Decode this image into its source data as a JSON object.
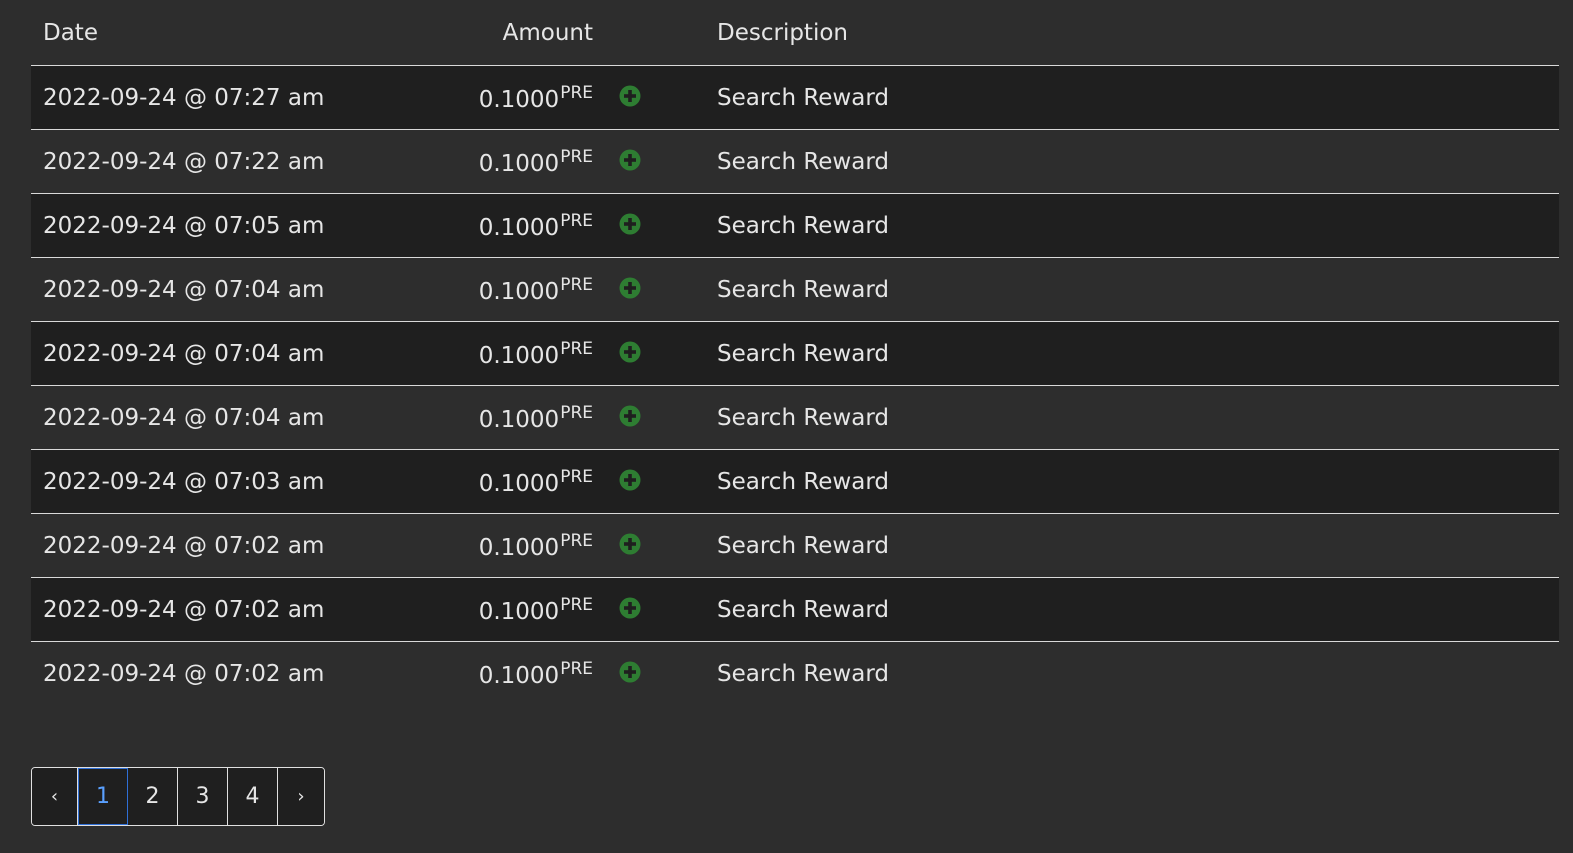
{
  "table": {
    "headers": {
      "date": "Date",
      "amount": "Amount",
      "description": "Description"
    },
    "rows": [
      {
        "date": "2022-09-24 @ 07:27 am",
        "amount": "0.1000",
        "unit": "PRE",
        "description": "Search Reward"
      },
      {
        "date": "2022-09-24 @ 07:22 am",
        "amount": "0.1000",
        "unit": "PRE",
        "description": "Search Reward"
      },
      {
        "date": "2022-09-24 @ 07:05 am",
        "amount": "0.1000",
        "unit": "PRE",
        "description": "Search Reward"
      },
      {
        "date": "2022-09-24 @ 07:04 am",
        "amount": "0.1000",
        "unit": "PRE",
        "description": "Search Reward"
      },
      {
        "date": "2022-09-24 @ 07:04 am",
        "amount": "0.1000",
        "unit": "PRE",
        "description": "Search Reward"
      },
      {
        "date": "2022-09-24 @ 07:04 am",
        "amount": "0.1000",
        "unit": "PRE",
        "description": "Search Reward"
      },
      {
        "date": "2022-09-24 @ 07:03 am",
        "amount": "0.1000",
        "unit": "PRE",
        "description": "Search Reward"
      },
      {
        "date": "2022-09-24 @ 07:02 am",
        "amount": "0.1000",
        "unit": "PRE",
        "description": "Search Reward"
      },
      {
        "date": "2022-09-24 @ 07:02 am",
        "amount": "0.1000",
        "unit": "PRE",
        "description": "Search Reward"
      },
      {
        "date": "2022-09-24 @ 07:02 am",
        "amount": "0.1000",
        "unit": "PRE",
        "description": "Search Reward"
      }
    ],
    "row_icon": "plus-circle-icon",
    "icon_color": "#2e7d32"
  },
  "pagination": {
    "prev_label": "‹",
    "next_label": "›",
    "pages": [
      "1",
      "2",
      "3",
      "4"
    ],
    "current": "1",
    "active_color": "#5aa0ff"
  }
}
